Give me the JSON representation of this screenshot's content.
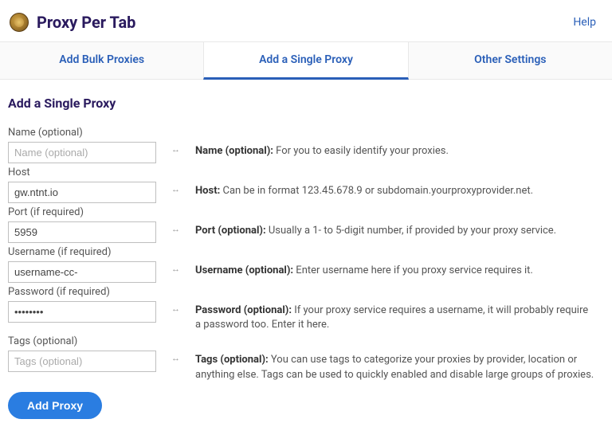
{
  "header": {
    "title": "Proxy Per Tab",
    "help": "Help"
  },
  "tabs": {
    "bulk": "Add Bulk Proxies",
    "single": "Add a Single Proxy",
    "other": "Other Settings"
  },
  "section_title": "Add a Single Proxy",
  "fields": {
    "name": {
      "label": "Name (optional)",
      "placeholder": "Name (optional)",
      "value": ""
    },
    "host": {
      "label": "Host",
      "placeholder": "",
      "value": "gw.ntnt.io"
    },
    "port": {
      "label": "Port (if required)",
      "placeholder": "",
      "value": "5959"
    },
    "username": {
      "label": "Username (if required)",
      "placeholder": "",
      "value": "username-cc-"
    },
    "password": {
      "label": "Password (if required)",
      "placeholder": "",
      "value": "••••••••"
    },
    "tags": {
      "label": "Tags (optional)",
      "placeholder": "Tags (optional)",
      "value": ""
    }
  },
  "hints": {
    "name": {
      "bold": "Name (optional):",
      "text": " For you to easily identify your proxies."
    },
    "host": {
      "bold": "Host:",
      "text": " Can be in format 123.45.678.9 or subdomain.yourproxyprovider.net."
    },
    "port": {
      "bold": "Port (optional):",
      "text": " Usually a 1- to 5-digit number, if provided by your proxy service."
    },
    "username": {
      "bold": "Username (optional):",
      "text": " Enter username here if you proxy service requires it."
    },
    "password": {
      "bold": "Password (optional):",
      "text": " If your proxy service requires a username, it will probably require a password too. Enter it here."
    },
    "tags": {
      "bold": "Tags (optional):",
      "text": " You can use tags to categorize your proxies by provider, location or anything else. Tags can be used to quickly enabled and disable large groups of proxies."
    }
  },
  "button": "Add Proxy",
  "arrow": "↔"
}
